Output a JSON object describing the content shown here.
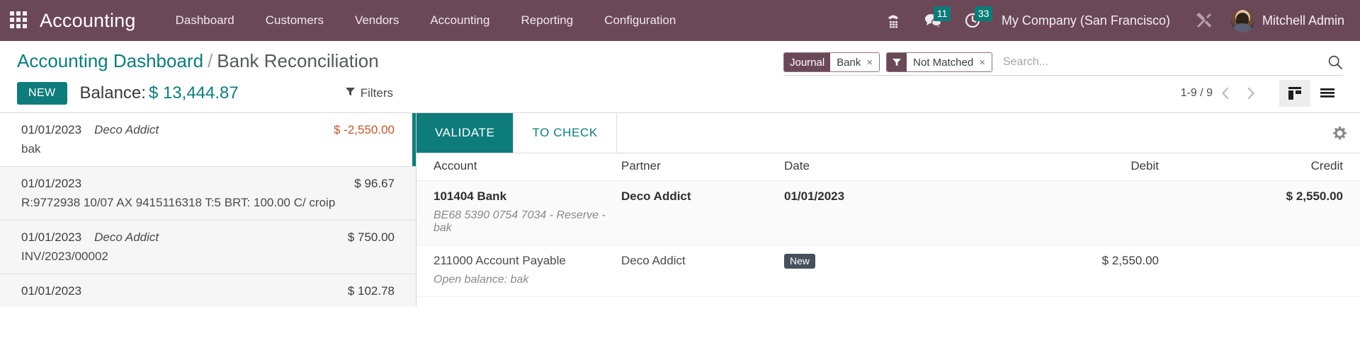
{
  "navbar": {
    "apps_icon": "apps-grid-icon",
    "brand": "Accounting",
    "menu": [
      {
        "label": "Dashboard"
      },
      {
        "label": "Customers"
      },
      {
        "label": "Vendors"
      },
      {
        "label": "Accounting"
      },
      {
        "label": "Reporting"
      },
      {
        "label": "Configuration"
      }
    ],
    "systray": {
      "phone_icon": "phone-icon",
      "messages_icon": "chat-bubble-icon",
      "messages_count": "11",
      "activities_icon": "clock-icon",
      "activities_count": "33",
      "company": "My Company (San Francisco)",
      "tools_icon": "tools-icon",
      "avatar_icon": "user-avatar",
      "user": "Mitchell Admin"
    }
  },
  "control_panel": {
    "breadcrumb": {
      "parent": "Accounting Dashboard",
      "separator": "/",
      "current": "Bank Reconciliation"
    },
    "new_label": "NEW",
    "balance_label": "Balance:",
    "balance_amount": "$ 13,444.87",
    "filters_label": "Filters",
    "filters_icon": "funnel-icon",
    "search": {
      "placeholder": "Search...",
      "value": "",
      "search_icon": "search-icon",
      "facets": [
        {
          "label": "Journal",
          "value": "Bank",
          "remove": "×",
          "icon": null
        },
        {
          "label": null,
          "value": "Not Matched",
          "remove": "×",
          "icon": "funnel-icon"
        }
      ]
    },
    "pager": {
      "range": "1-9 / 9",
      "prev_icon": "chevron-left-icon",
      "next_icon": "chevron-right-icon"
    },
    "views": [
      {
        "name": "kanban-view-icon",
        "active": true
      },
      {
        "name": "list-view-icon",
        "active": false
      }
    ]
  },
  "statement_lines": [
    {
      "date": "01/01/2023",
      "partner": "Deco Addict",
      "amount": "$ -2,550.00",
      "negative": true,
      "reference": "bak",
      "selected": true
    },
    {
      "date": "01/01/2023",
      "partner": "",
      "amount": "$ 96.67",
      "negative": false,
      "reference": "R:9772938 10/07 AX 9415116318 T:5 BRT: 100.00 C/ croip",
      "selected": false
    },
    {
      "date": "01/01/2023",
      "partner": "Deco Addict",
      "amount": "$ 750.00",
      "negative": false,
      "reference": "INV/2023/00002",
      "selected": false
    },
    {
      "date": "01/01/2023",
      "partner": "",
      "amount": "$ 102.78",
      "negative": false,
      "reference": "",
      "selected": false
    }
  ],
  "reconciliation": {
    "tabs": [
      {
        "label": "VALIDATE",
        "style": "primary"
      },
      {
        "label": "TO CHECK",
        "style": "secondary"
      }
    ],
    "settings_icon": "gear-icon",
    "columns": {
      "account": "Account",
      "partner": "Partner",
      "date": "Date",
      "debit": "Debit",
      "credit": "Credit"
    },
    "rows": [
      {
        "account": "101404 Bank",
        "account_sub": "BE68 5390 0754 7034 - Reserve - bak",
        "partner": "Deco Addict",
        "date": "01/01/2023",
        "date_badge": "",
        "debit": "",
        "credit": "$ 2,550.00",
        "bold": true
      },
      {
        "account": "211000 Account Payable",
        "account_sub": "Open balance: bak",
        "partner": "Deco Addict",
        "date": "",
        "date_badge": "New",
        "debit": "$ 2,550.00",
        "credit": "",
        "bold": false
      }
    ]
  },
  "colors": {
    "navbar": "#6b4858",
    "accent_teal": "#0e7c7b",
    "badge_teal": "#0d7b78",
    "negative_amount": "#c0562f",
    "new_pill": "#46505c"
  }
}
